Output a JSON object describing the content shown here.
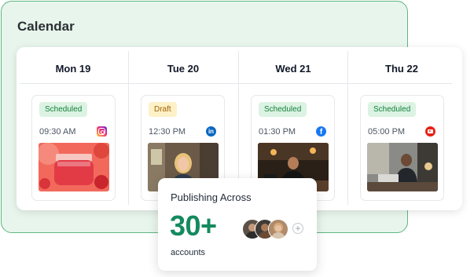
{
  "panel": {
    "title": "Calendar"
  },
  "calendar": {
    "days": [
      {
        "label": "Mon 19",
        "status": "Scheduled",
        "time": "09:30 AM",
        "network": "instagram-icon"
      },
      {
        "label": "Tue 20",
        "status": "Draft",
        "time": "12:30 PM",
        "network": "linkedin-icon"
      },
      {
        "label": "Wed 21",
        "status": "Scheduled",
        "time": "01:30 PM",
        "network": "facebook-icon"
      },
      {
        "label": "Thu 22",
        "status": "Scheduled",
        "time": "05:00 PM",
        "network": "youtube-icon"
      }
    ]
  },
  "publishing": {
    "title": "Publishing Across",
    "count": "30+",
    "unit": "accounts",
    "more_icon": "plus-icon"
  },
  "colors": {
    "panel_bg": "#e8f5ec",
    "panel_border": "#5fb582",
    "accent": "#148a5e",
    "scheduled_bg": "#dcf3e3",
    "scheduled_text": "#15803d",
    "draft_bg": "#fdf1c7",
    "draft_text": "#a16207"
  }
}
